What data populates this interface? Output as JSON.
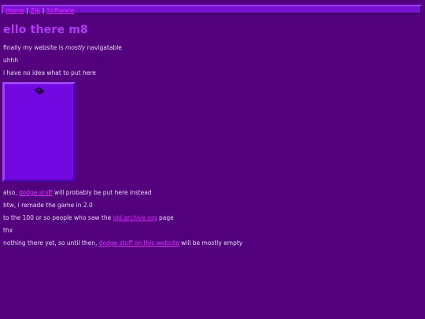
{
  "nav": {
    "links": [
      "Home",
      "Zip",
      "Software"
    ],
    "separator": "|"
  },
  "page": {
    "title": "ello there m8",
    "line1": {
      "before": "finally my website is ",
      "emph": "mostly",
      "after": " navigatable"
    },
    "line2": "uhhh",
    "line3": "i have no idea what to put here",
    "line4": {
      "before": "also, ",
      "link": "dodge stuff",
      "after": " will probably be put here instead"
    },
    "line5": "btw, i remade the game in 2.0",
    "line6": {
      "before": "to the 100 or so people who saw the ",
      "link": "old.archive.org",
      "after": " page"
    },
    "line7": "thx",
    "line8": {
      "before": "nothing there yet, so until then, ",
      "link": "dodge stuff on this website",
      "after": " will be mostly empty"
    }
  },
  "colors": {
    "background": "#53007c",
    "nav_bar": "#7a10d0",
    "link": "#e02cff",
    "heading": "#b03cf6",
    "game_canvas": "#7408e3"
  }
}
